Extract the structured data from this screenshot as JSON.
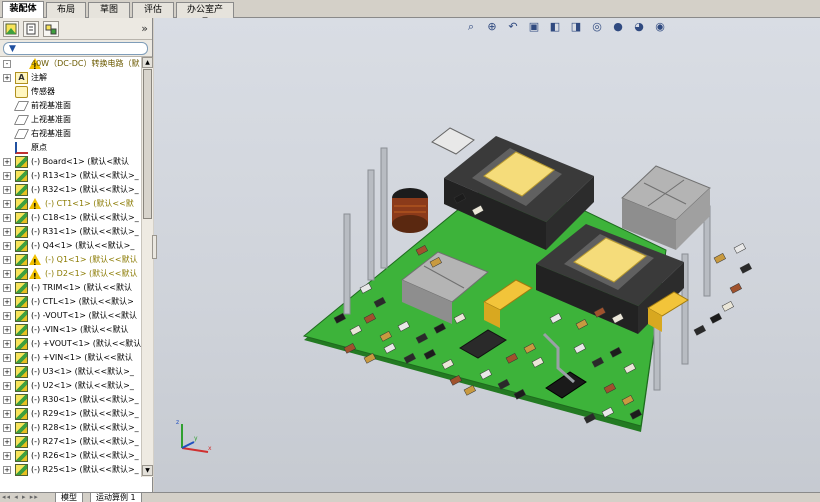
{
  "tabs": [
    {
      "label": "装配体",
      "active": true
    },
    {
      "label": "布局",
      "active": false
    },
    {
      "label": "草图",
      "active": false
    },
    {
      "label": "评估",
      "active": false
    },
    {
      "label": "办公室产品",
      "active": false
    }
  ],
  "panel": {
    "collapse_label": "»",
    "filter_icon": "▼",
    "tree": [
      {
        "label": "40W（DC-DC）转换电路（默",
        "icon": "assembly",
        "warn": true,
        "type": "root",
        "expander": "-"
      },
      {
        "label": "注解",
        "icon": "note",
        "warn": false,
        "expander": "+"
      },
      {
        "label": "传感器",
        "icon": "sensor",
        "warn": false,
        "expander": ""
      },
      {
        "label": "前视基准面",
        "icon": "plane",
        "warn": false,
        "expander": ""
      },
      {
        "label": "上视基准面",
        "icon": "plane",
        "warn": false,
        "expander": ""
      },
      {
        "label": "右视基准面",
        "icon": "plane",
        "warn": false,
        "expander": ""
      },
      {
        "label": "原点",
        "icon": "origin",
        "warn": false,
        "expander": ""
      },
      {
        "label": "(-) Board<1> (默认<默认",
        "icon": "part",
        "warn": false,
        "expander": "+"
      },
      {
        "label": "(-) R13<1> (默认<<默认>_",
        "icon": "part",
        "warn": false,
        "expander": "+"
      },
      {
        "label": "(-) R32<1> (默认<<默认>_",
        "icon": "part",
        "warn": false,
        "expander": "+"
      },
      {
        "label": "(-) CT1<1> (默认<<默",
        "icon": "part",
        "warn": true,
        "expander": "+"
      },
      {
        "label": "(-) C18<1> (默认<<默认>_",
        "icon": "part",
        "warn": false,
        "expander": "+"
      },
      {
        "label": "(-) R31<1> (默认<<默认>_",
        "icon": "part",
        "warn": false,
        "expander": "+"
      },
      {
        "label": "(-) Q4<1> (默认<<默认>_",
        "icon": "part",
        "warn": false,
        "expander": "+"
      },
      {
        "label": "(-) Q1<1> (默认<<默认",
        "icon": "part",
        "warn": true,
        "expander": "+"
      },
      {
        "label": "(-) D2<1> (默认<<默认",
        "icon": "part",
        "warn": true,
        "expander": "+"
      },
      {
        "label": "(-) TRIM<1> (默认<<默认",
        "icon": "part",
        "warn": false,
        "expander": "+"
      },
      {
        "label": "(-) CTL<1> (默认<<默认>",
        "icon": "part",
        "warn": false,
        "expander": "+"
      },
      {
        "label": "(-) -VOUT<1> (默认<<默认",
        "icon": "part",
        "warn": false,
        "expander": "+"
      },
      {
        "label": "(-) -VIN<1> (默认<<默认",
        "icon": "part",
        "warn": false,
        "expander": "+"
      },
      {
        "label": "(-) +VOUT<1> (默认<<默认",
        "icon": "part",
        "warn": false,
        "expander": "+"
      },
      {
        "label": "(-) +VIN<1> (默认<<默认",
        "icon": "part",
        "warn": false,
        "expander": "+"
      },
      {
        "label": "(-) U3<1> (默认<<默认>_",
        "icon": "part",
        "warn": false,
        "expander": "+"
      },
      {
        "label": "(-) U2<1> (默认<<默认>_",
        "icon": "part",
        "warn": false,
        "expander": "+"
      },
      {
        "label": "(-) R30<1> (默认<<默认>_",
        "icon": "part",
        "warn": false,
        "expander": "+"
      },
      {
        "label": "(-) R29<1> (默认<<默认>_",
        "icon": "part",
        "warn": false,
        "expander": "+"
      },
      {
        "label": "(-) R28<1> (默认<<默认>_",
        "icon": "part",
        "warn": false,
        "expander": "+"
      },
      {
        "label": "(-) R27<1> (默认<<默认>_",
        "icon": "part",
        "warn": false,
        "expander": "+"
      },
      {
        "label": "(-) R26<1> (默认<<默认>_",
        "icon": "part",
        "warn": false,
        "expander": "+"
      },
      {
        "label": "(-) R25<1> (默认<<默认>_",
        "icon": "part",
        "warn": false,
        "expander": "+"
      }
    ]
  },
  "bottom_tabs": [
    {
      "label": "模型"
    },
    {
      "label": "运动算例 1"
    }
  ],
  "bottom_nav": "◂◂ ◂ ▸ ▸▸",
  "view_toolbar": [
    "zoom-fit-icon",
    "zoom-area-icon",
    "previous-view-icon",
    "section-view-icon",
    "view-orientation-icon",
    "display-style-icon",
    "hide-show-icon",
    "edit-appearance-icon",
    "apply-scene-icon",
    "view-settings-icon"
  ],
  "triad": {
    "x": "x",
    "y": "y",
    "z": "z"
  },
  "colors": {
    "board": "#3db33a",
    "board_dark": "#237a22",
    "panel_bg": "#ffffff",
    "viewport_bg": "#d4d8de"
  }
}
